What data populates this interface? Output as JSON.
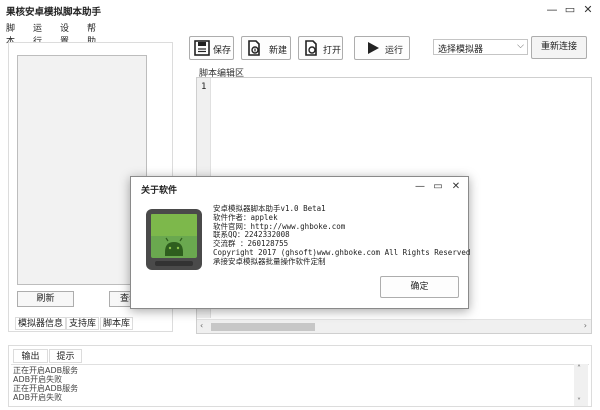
{
  "window": {
    "title": "果核安卓模拟脚本助手"
  },
  "menu": [
    "脚本",
    "运行",
    "设置",
    "帮助"
  ],
  "toolbar": {
    "save": "保存",
    "new": "新建",
    "open": "打开",
    "run": "运行",
    "emulator_select": "选择模拟器",
    "reconnect": "重新连接"
  },
  "left_panel": {
    "refresh": "刷新",
    "view": "查看",
    "tabs": [
      "模拟器信息",
      "支持库",
      "脚本库"
    ]
  },
  "editor": {
    "label": "脚本编辑区",
    "line_number": "1"
  },
  "output": {
    "tabs": [
      "输出",
      "提示"
    ],
    "lines": [
      "正在开启ADB服务",
      "ADB开启失败",
      "正在开启ADB服务",
      "ADB开启失败"
    ]
  },
  "dialog": {
    "title": "关于软件",
    "lines": [
      "安卓模拟器脚本助手v1.0 Beta1",
      "软件作者：applek",
      "软件官网：http://www.ghboke.com",
      "联系QQ：2242332008",
      "交流群  ：260128755",
      "Copyright 2017 (ghsoft)www.ghboke.com All Rights Reserved",
      "承接安卓模拟器批量操作软件定制"
    ],
    "ok": "确定"
  },
  "colors": {
    "android_green": "#8bc34a",
    "logo_dark": "#4a4a4a"
  }
}
